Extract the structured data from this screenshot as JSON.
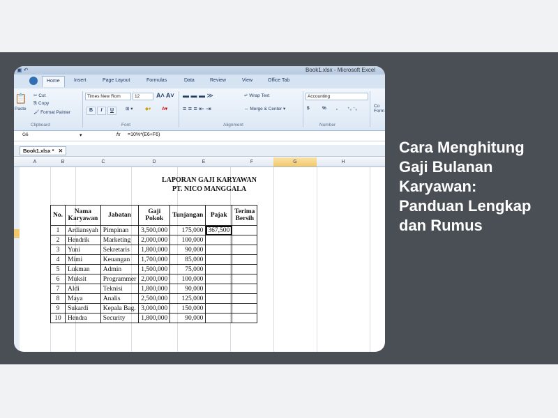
{
  "headline": "Cara Menghitung Gaji Bulanan Karyawan: Panduan Lengkap dan Rumus",
  "window": {
    "title": "Book1.xlsx - Microsoft Excel"
  },
  "ribbon": {
    "tabs": [
      "Home",
      "Insert",
      "Page Layout",
      "Formulas",
      "Data",
      "Review",
      "View",
      "Office Tab"
    ],
    "clipboard": {
      "paste": "Paste",
      "cut": "Cut",
      "copy": "Copy",
      "format_painter": "Format Painter",
      "label": "Clipboard"
    },
    "font": {
      "name": "Times New Rom",
      "size": "12",
      "bold": "B",
      "italic": "I",
      "underline": "U",
      "label": "Font"
    },
    "alignment": {
      "wrap_text": "Wrap Text",
      "merge_center": "Merge & Center",
      "label": "Alignment"
    },
    "number": {
      "format": "Accounting",
      "currency": "$",
      "percent": "%",
      "comma": ",",
      "label": "Number"
    },
    "styles_partial": "Co Form"
  },
  "formula_bar": {
    "name_box": "G6",
    "fx": "fx",
    "formula": "=10%*(E6+F6)"
  },
  "workbook_tab": {
    "label": "Book1.xlsx *",
    "close": "✕"
  },
  "columns": [
    "A",
    "B",
    "C",
    "D",
    "E",
    "F",
    "G",
    "H"
  ],
  "sheet": {
    "title": "LAPORAN GAJI KARYAWAN",
    "subtitle": "PT. NICO MANGGALA",
    "headers": [
      "No.",
      "Nama Karyawan",
      "Jabatan",
      "Gaji Pokok",
      "Tunjangan",
      "Pajak",
      "Terima Bersih"
    ],
    "rows": [
      [
        "1",
        "Ardiansyah",
        "Pimpinan",
        "3,500,000",
        "175,000",
        "367,500",
        ""
      ],
      [
        "2",
        "Hendrik",
        "Marketing",
        "2,000,000",
        "100,000",
        "",
        ""
      ],
      [
        "3",
        "Yuni",
        "Sekretaris",
        "1,800,000",
        "90,000",
        "",
        ""
      ],
      [
        "4",
        "Mimi",
        "Keuangan",
        "1,700,000",
        "85,000",
        "",
        ""
      ],
      [
        "5",
        "Lukman",
        "Admin",
        "1,500,000",
        "75,000",
        "",
        ""
      ],
      [
        "6",
        "Muksit",
        "Programmer",
        "2,000,000",
        "100,000",
        "",
        ""
      ],
      [
        "7",
        "Aldi",
        "Teknisi",
        "1,800,000",
        "90,000",
        "",
        ""
      ],
      [
        "8",
        "Maya",
        "Analis",
        "2,500,000",
        "125,000",
        "",
        ""
      ],
      [
        "9",
        "Sukardi",
        "Kepala Bag.",
        "3,000,000",
        "150,000",
        "",
        ""
      ],
      [
        "10",
        "Hendra",
        "Security",
        "1,800,000",
        "90,000",
        "",
        ""
      ]
    ]
  }
}
